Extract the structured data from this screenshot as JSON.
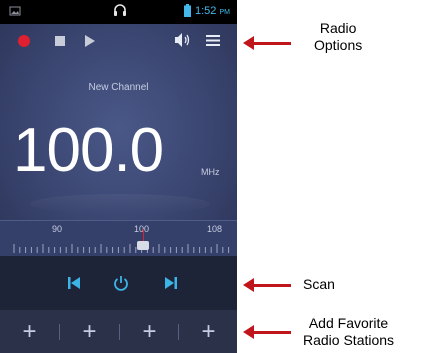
{
  "status_bar": {
    "time": "1:52",
    "ampm": "PM"
  },
  "radio": {
    "channel_name": "New Channel",
    "frequency": "100.0",
    "unit": "MHz",
    "dial_labels": [
      "90",
      "100",
      "108"
    ],
    "dial_value": 100
  },
  "favorites": [
    "+",
    "+",
    "+",
    "+"
  ],
  "annotations": {
    "radio_options": [
      "Radio",
      "Options"
    ],
    "scan": "Scan",
    "add_favorites": [
      "Add Favorite",
      "Radio Stations"
    ]
  },
  "colors": {
    "accent": "#44b8ea",
    "record": "#e02030",
    "arrow": "#c0161b"
  }
}
